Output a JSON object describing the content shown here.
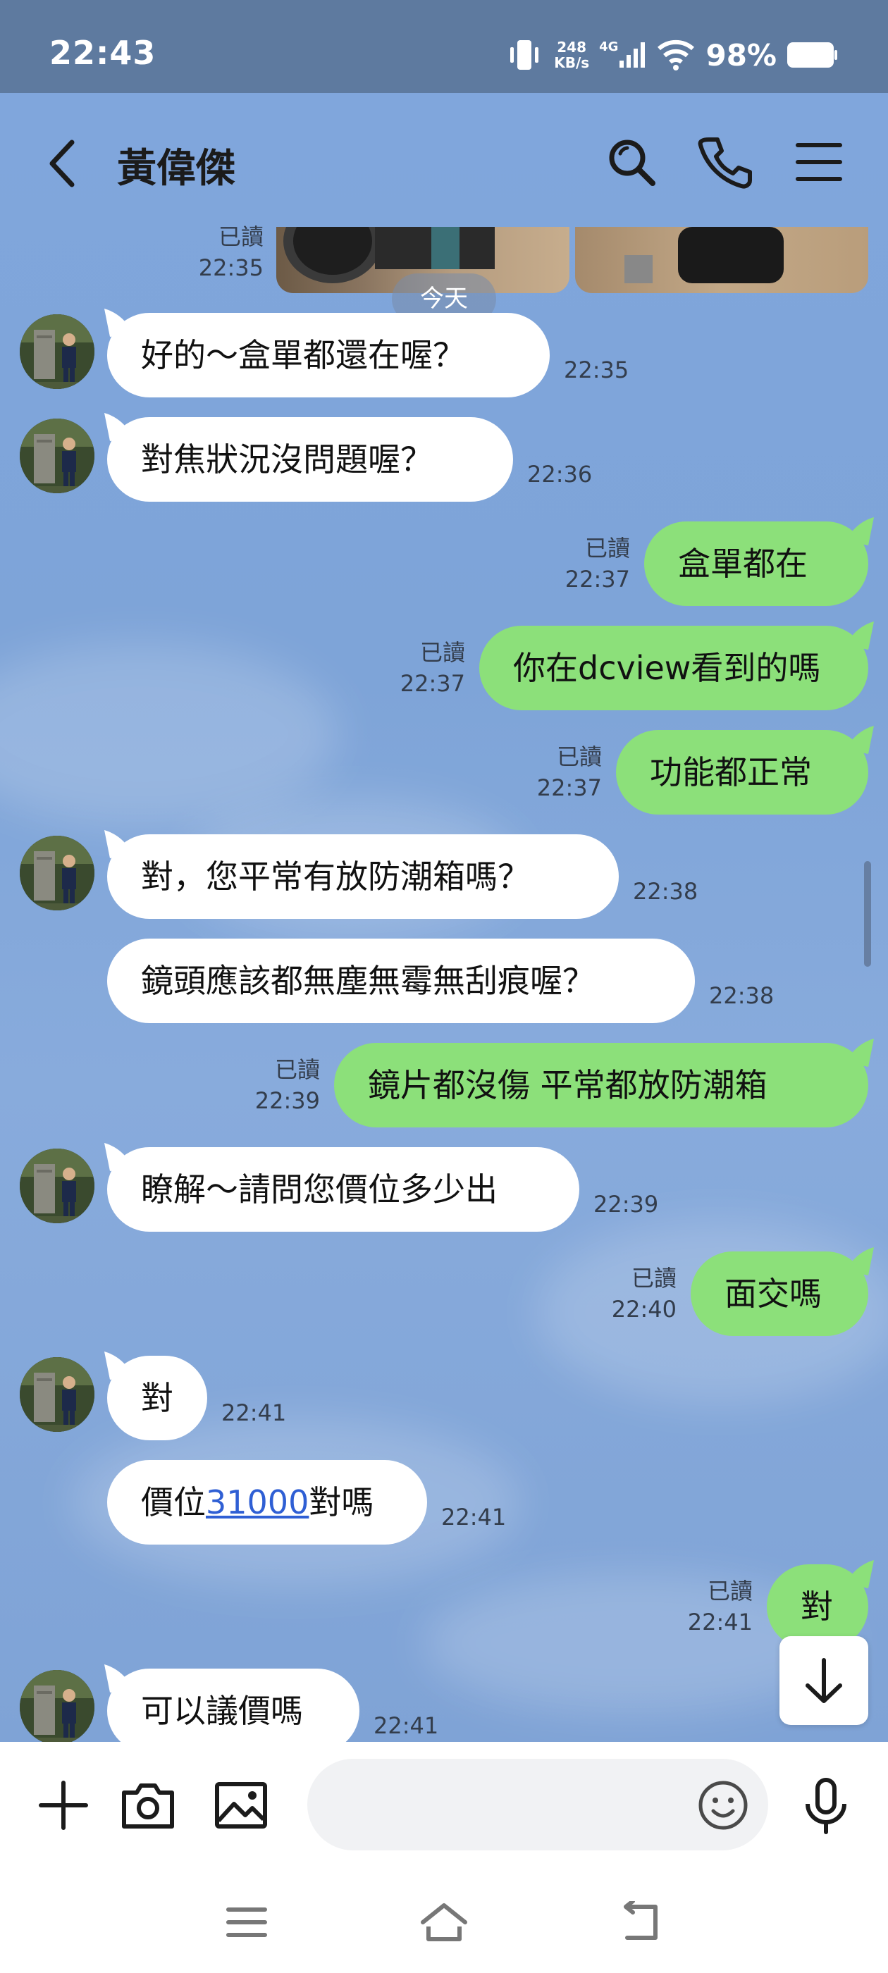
{
  "status_bar": {
    "time": "22:43",
    "net_speed_value": "248",
    "net_speed_unit": "KB/s",
    "network_type": "4G",
    "battery_percent": "98%"
  },
  "header": {
    "contact_name": "黃偉傑",
    "icons": [
      "back-icon",
      "search-icon",
      "phone-icon",
      "menu-icon"
    ]
  },
  "top_message": {
    "status": "已讀",
    "time": "22:35"
  },
  "date_separator": "今天",
  "messages": [
    {
      "dir": "in",
      "text": "好的～盒單都還在喔？",
      "time": "22:35"
    },
    {
      "dir": "in",
      "text": "對焦狀況沒問題喔？",
      "time": "22:36"
    },
    {
      "dir": "out",
      "text": "盒單都在",
      "status": "已讀",
      "time": "22:37"
    },
    {
      "dir": "out",
      "text": "你在dcview看到的嗎",
      "status": "已讀",
      "time": "22:37"
    },
    {
      "dir": "out",
      "text": "功能都正常",
      "status": "已讀",
      "time": "22:37"
    },
    {
      "dir": "in",
      "text": "對，您平常有放防潮箱嗎？",
      "time": "22:38"
    },
    {
      "dir": "in",
      "text": "鏡頭應該都無塵無霉無刮痕喔？",
      "time": "22:38"
    },
    {
      "dir": "out",
      "text": "鏡片都沒傷 平常都放防潮箱",
      "status": "已讀",
      "time": "22:39"
    },
    {
      "dir": "in",
      "text": "瞭解～請問您價位多少出",
      "time": "22:39"
    },
    {
      "dir": "out",
      "text": "面交嗎",
      "status": "已讀",
      "time": "22:40"
    },
    {
      "dir": "in",
      "text": "對",
      "time": "22:41"
    },
    {
      "dir": "in",
      "text_prefix": "價位",
      "text_link": "31000",
      "text_suffix": "對嗎",
      "time": "22:41"
    },
    {
      "dir": "out",
      "text": "對",
      "status": "已讀",
      "time": "22:41"
    },
    {
      "dir": "in",
      "text": "可以議價嗎",
      "time": "22:41"
    }
  ],
  "input_bar": {
    "placeholder": "",
    "icons": [
      "plus-icon",
      "camera-icon",
      "image-icon",
      "emoji-icon",
      "microphone-icon"
    ]
  },
  "nav_bar": {
    "icons": [
      "recent-apps-icon",
      "home-icon",
      "back-nav-icon"
    ]
  },
  "colors": {
    "status_bar": "#5e7a9f",
    "chat_background": "#80a6dc",
    "incoming_bubble": "#ffffff",
    "outgoing_bubble": "#8ce07a",
    "link": "#2f5fd4"
  }
}
